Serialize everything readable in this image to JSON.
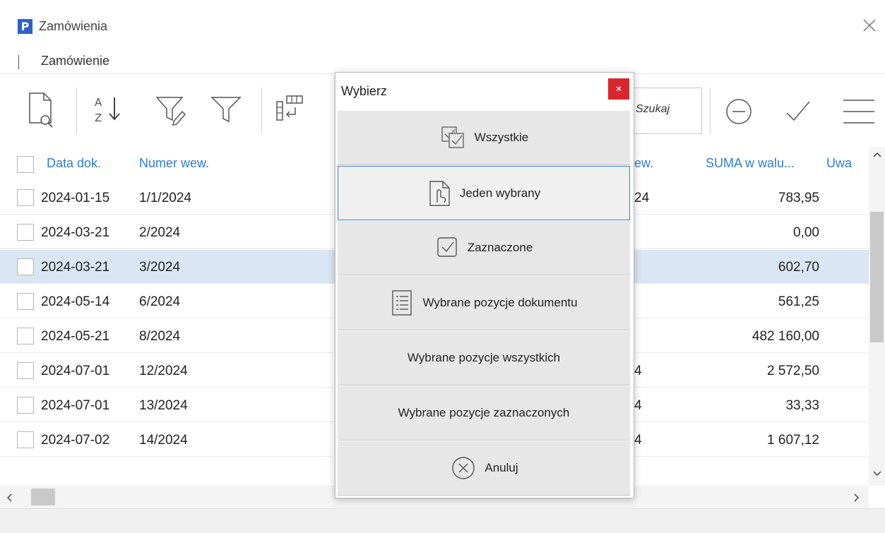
{
  "window": {
    "title": "Zamówienia",
    "logo": "P"
  },
  "menu": {
    "items": [
      "Zamówienie"
    ]
  },
  "toolbar": {
    "search_placeholder": "Szukaj",
    "icons": [
      "preview-icon",
      "sort-az-icon",
      "filter-edit-icon",
      "filter-icon",
      "columns-icon",
      "minus-circle-icon",
      "check-icon",
      "menu-icon"
    ]
  },
  "table": {
    "headers": {
      "date": "Data dok.",
      "number": "Numer wew.",
      "hidden_col": "ew.",
      "sum": "SUMA w walu...",
      "notes": "Uwa"
    },
    "rows": [
      {
        "date": "2024-01-15",
        "number": "1/1/2024",
        "partial": "24",
        "sum": "783,95",
        "selected": false
      },
      {
        "date": "2024-03-21",
        "number": "2/2024",
        "partial": "",
        "sum": "0,00",
        "selected": false
      },
      {
        "date": "2024-03-21",
        "number": "3/2024",
        "partial": "",
        "sum": "602,70",
        "selected": true
      },
      {
        "date": "2024-05-14",
        "number": "6/2024",
        "partial": "",
        "sum": "561,25",
        "selected": false
      },
      {
        "date": "2024-05-21",
        "number": "8/2024",
        "partial": "",
        "sum": "482 160,00",
        "selected": false
      },
      {
        "date": "2024-07-01",
        "number": "12/2024",
        "partial": "4",
        "sum": "2 572,50",
        "selected": false
      },
      {
        "date": "2024-07-01",
        "number": "13/2024",
        "partial": "4",
        "sum": "33,33",
        "selected": false
      },
      {
        "date": "2024-07-02",
        "number": "14/2024",
        "partial": "4",
        "sum": "1 607,12",
        "selected": false
      }
    ]
  },
  "dialog": {
    "title": "Wybierz",
    "close": "×",
    "options": [
      {
        "label": "Wszystkie",
        "icon": "check-all-icon"
      },
      {
        "label": "Jeden wybrany",
        "icon": "hand-pointer-icon"
      },
      {
        "label": "Zaznaczone",
        "icon": "checkbox-checked-icon"
      },
      {
        "label": "Wybrane pozycje dokumentu",
        "icon": "list-document-icon"
      },
      {
        "label": "Wybrane pozycje wszystkich",
        "icon": ""
      },
      {
        "label": "Wybrane pozycje zaznaczonych",
        "icon": ""
      },
      {
        "label": "Anuluj",
        "icon": "cancel-circle-icon"
      }
    ]
  },
  "colors": {
    "accent": "#2e7dd1",
    "selected_row": "#dbe6f4",
    "close_red": "#d9262d",
    "logo_blue": "#2f5fcf"
  }
}
